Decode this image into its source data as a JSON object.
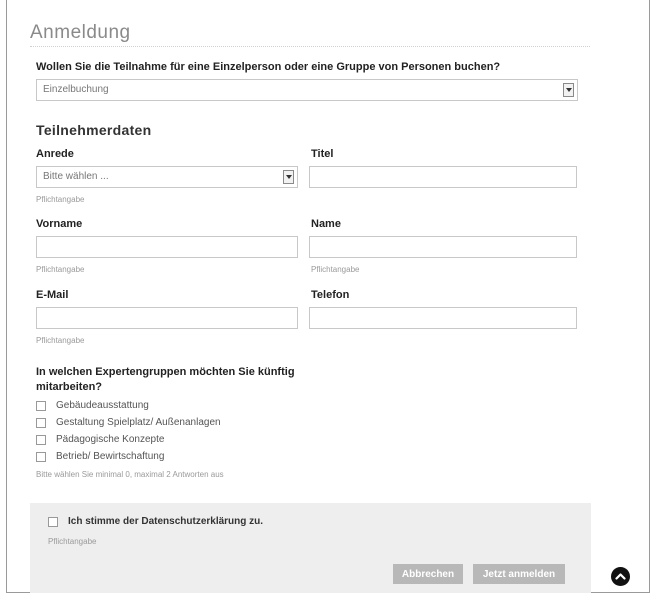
{
  "form": {
    "title": "Anmeldung",
    "booking_question": "Wollen Sie die Teilnahme für eine Einzelperson oder eine Gruppe von Personen buchen?",
    "booking_type": {
      "value": "Einzelbuchung"
    }
  },
  "participant": {
    "section_title": "Teilnehmerdaten",
    "salutation": {
      "label": "Anrede",
      "placeholder": "Bitte wählen ...",
      "hint": "Pflichtangabe"
    },
    "title_field": {
      "label": "Titel",
      "value": ""
    },
    "first_name": {
      "label": "Vorname",
      "value": "",
      "hint": "Pflichtangabe"
    },
    "last_name": {
      "label": "Name",
      "value": "",
      "hint": "Pflichtangabe"
    },
    "email": {
      "label": "E-Mail",
      "value": "",
      "hint": "Pflichtangabe"
    },
    "phone": {
      "label": "Telefon",
      "value": ""
    }
  },
  "expert_groups": {
    "question_line1": "In welchen Expertengruppen möchten Sie künftig",
    "question_line2": "mitarbeiten?",
    "options": [
      {
        "label": "Gebäudeausstattung",
        "checked": false
      },
      {
        "label": "Gestaltung Spielplatz/ Außenanlagen",
        "checked": false
      },
      {
        "label": "Pädagogische Konzepte",
        "checked": false
      },
      {
        "label": "Betrieb/ Bewirtschaftung",
        "checked": false
      }
    ],
    "hint": "Bitte wählen Sie minimal 0, maximal 2 Antworten aus"
  },
  "privacy": {
    "label": "Ich stimme der Datenschutzerklärung zu.",
    "hint": "Pflichtangabe",
    "checked": false
  },
  "actions": {
    "cancel_label": "Abbrechen",
    "submit_label": "Jetzt anmelden"
  },
  "icons": {
    "dropdown": "chevron-down-icon",
    "scroll_top": "chevron-up-icon"
  },
  "colors": {
    "button_bg": "#b8b8b8",
    "panel_bg": "#eeeeee",
    "title_color": "#8a8a8a"
  }
}
